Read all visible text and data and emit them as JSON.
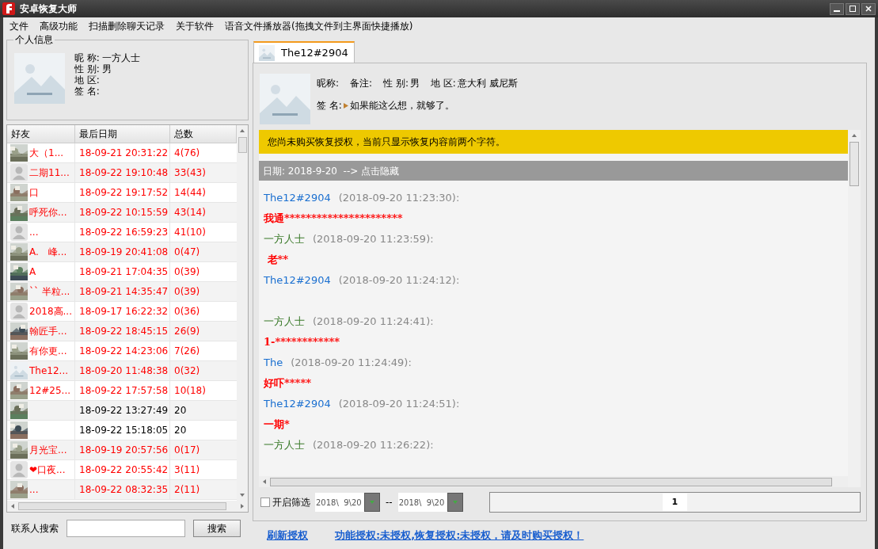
{
  "window": {
    "title": "安卓恢复大师"
  },
  "menu": [
    "文件",
    "高级功能",
    "扫描删除聊天记录",
    "关于软件",
    "语音文件播放器(拖拽文件到主界面快捷播放)"
  ],
  "profile": {
    "group_title": "个人信息",
    "fields": [
      {
        "label": "昵 称:",
        "value": "一方人士"
      },
      {
        "label": "性 别:",
        "value": "男"
      },
      {
        "label": "地 区:"
      },
      {
        "label": "签 名:"
      }
    ]
  },
  "friends": {
    "columns": [
      "好友",
      "最后日期",
      "总数"
    ],
    "rows": [
      {
        "kind": "picture",
        "name": "大（1...",
        "date": "18-09-21 20:31:22",
        "count": "4(76)",
        "highlighted": true
      },
      {
        "kind": "default",
        "name": "二期11...",
        "date": "18-09-22 19:10:48",
        "count": "33(43)",
        "highlighted": true
      },
      {
        "kind": "picture",
        "name": "口",
        "date": "18-09-22 19:17:52",
        "count": "14(44)",
        "highlighted": true
      },
      {
        "kind": "picture",
        "name": "呼死你...",
        "date": "18-09-22 10:15:59",
        "count": "43(14)",
        "highlighted": true
      },
      {
        "kind": "default",
        "name": "...",
        "date": "18-09-22 16:59:23",
        "count": "41(10)",
        "highlighted": true
      },
      {
        "kind": "picture",
        "name": "A.　峰...",
        "date": "18-09-19 20:41:08",
        "count": "0(47)",
        "highlighted": true
      },
      {
        "kind": "picture",
        "name": "A",
        "date": "18-09-21 17:04:35",
        "count": "0(39)",
        "highlighted": true
      },
      {
        "kind": "picture",
        "name": "`` 半粒...",
        "date": "18-09-21 14:35:47",
        "count": "0(39)",
        "highlighted": true
      },
      {
        "kind": "default",
        "name": "2018高...",
        "date": "18-09-17 16:22:32",
        "count": "0(36)",
        "highlighted": true
      },
      {
        "kind": "picture",
        "name": "翰匠手...",
        "date": "18-09-22 18:45:15",
        "count": "26(9)",
        "highlighted": true
      },
      {
        "kind": "picture",
        "name": "有你更...",
        "date": "18-09-22 14:23:06",
        "count": "7(26)",
        "highlighted": true
      },
      {
        "kind": "placeholder",
        "name": "The12...",
        "date": "18-09-20 11:48:38",
        "count": "0(32)",
        "highlighted": true
      },
      {
        "kind": "picture",
        "name": "12#25...",
        "date": "18-09-22 17:57:58",
        "count": "10(18)",
        "highlighted": true
      },
      {
        "kind": "picture",
        "date": "18-09-22 13:27:49",
        "count": "20",
        "highlighted": false
      },
      {
        "kind": "picture",
        "date": "18-09-22 15:18:05",
        "count": "20",
        "highlighted": false
      },
      {
        "kind": "picture",
        "name": "月光宝...",
        "date": "18-09-19 20:57:56",
        "count": "0(17)",
        "highlighted": true
      },
      {
        "kind": "default",
        "name": "❤口夜...",
        "date": "18-09-22 20:55:42",
        "count": "3(11)",
        "highlighted": true
      },
      {
        "kind": "picture",
        "name": "...",
        "date": "18-09-22 08:32:35",
        "count": "2(11)",
        "highlighted": true
      }
    ]
  },
  "search": {
    "label": "联系人搜索",
    "button": "搜索"
  },
  "tabs": [
    {
      "label": "The12#2904",
      "selected": true
    }
  ],
  "contact": {
    "fields": [
      {
        "label": "昵称:"
      },
      {
        "label": "备注:"
      },
      {
        "label": "性 别:",
        "value": "男"
      },
      {
        "label": "地 区:",
        "value": "意大利 威尼斯"
      }
    ],
    "signature_label": "签 名:",
    "signature": "如果能这么想，就够了。"
  },
  "notice": "您尚未购买恢复授权，当前只显示恢复内容前两个字符。",
  "date_bar": "日期: 2018-9-20  --> 点击隐藏",
  "messages": [
    {
      "sender": "The12#2904",
      "kind": "friend",
      "time": "(2018-09-20 11:23:30):",
      "content": "我通**********************"
    },
    {
      "sender": "一方人士",
      "kind": "self",
      "time": "(2018-09-20 11:23:59):",
      "content": " 老**"
    },
    {
      "sender": "The12#2904",
      "kind": "friend",
      "time": "(2018-09-20 11:24:12):"
    },
    {
      "sender": "一方人士",
      "kind": "self",
      "time": "(2018-09-20 11:24:41):",
      "content": "1-************"
    },
    {
      "sender": "The",
      "kind": "friend",
      "time": "(2018-09-20 11:24:49):",
      "content": "好吓*****"
    },
    {
      "sender": "The12#2904",
      "kind": "friend",
      "time": "(2018-09-20 11:24:51):",
      "content": "一期*"
    },
    {
      "sender": "一方人士",
      "kind": "self",
      "time": "(2018-09-20 11:26:22):"
    }
  ],
  "filter": {
    "label": "开启筛选",
    "checked": false,
    "from": "2018\\  9\\20",
    "separator": "--",
    "to": "2018\\  9\\20",
    "page": "1"
  },
  "links": [
    "刷新授权",
    "功能授权:未授权,恢复授权:未授权，请及时购买授权！"
  ]
}
